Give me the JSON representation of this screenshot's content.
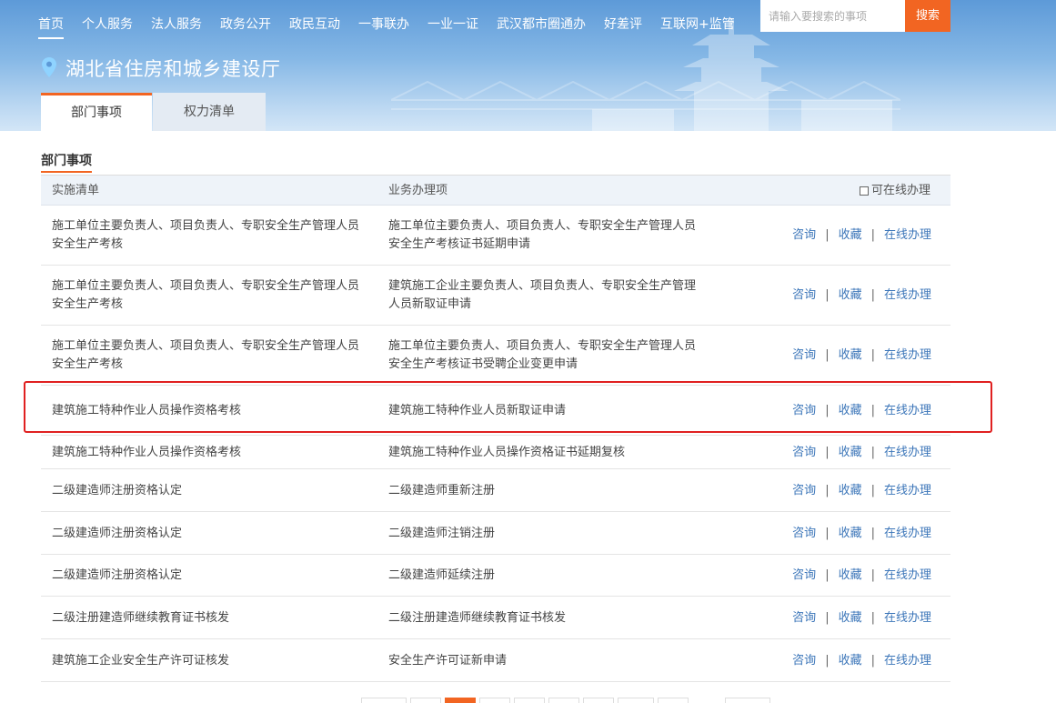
{
  "nav": {
    "items": [
      {
        "label": "首页",
        "active": true
      },
      {
        "label": "个人服务",
        "active": false
      },
      {
        "label": "法人服务",
        "active": false
      },
      {
        "label": "政务公开",
        "active": false
      },
      {
        "label": "政民互动",
        "active": false
      },
      {
        "label": "一事联办",
        "active": false
      },
      {
        "label": "一业一证",
        "active": false
      },
      {
        "label": "武汉都市圈通办",
        "active": false
      },
      {
        "label": "好差评",
        "active": false
      },
      {
        "label": "互联网+监管",
        "active": false
      }
    ]
  },
  "search": {
    "placeholder": "请输入要搜索的事项",
    "button_label": "搜索"
  },
  "department": {
    "title": "湖北省住房和城乡建设厅",
    "icon": "location-pin-icon"
  },
  "tabs": [
    {
      "label": "部门事项",
      "active": true
    },
    {
      "label": "权力清单",
      "active": false
    }
  ],
  "section": {
    "title": "部门事项"
  },
  "table": {
    "headers": {
      "implementation": "实施清单",
      "business": "业务办理项",
      "online_filter": "可在线办理"
    },
    "action_labels": {
      "consult": "咨询",
      "favorite": "收藏",
      "online": "在线办理"
    },
    "rows": [
      {
        "implementation": "施工单位主要负责人、项目负责人、专职安全生产管理人员安全生产考核",
        "business": "施工单位主要负责人、项目负责人、专职安全生产管理人员安全生产考核证书延期申请"
      },
      {
        "implementation": "施工单位主要负责人、项目负责人、专职安全生产管理人员安全生产考核",
        "business": "建筑施工企业主要负责人、项目负责人、专职安全生产管理人员新取证申请"
      },
      {
        "implementation": "施工单位主要负责人、项目负责人、专职安全生产管理人员安全生产考核",
        "business": "施工单位主要负责人、项目负责人、专职安全生产管理人员安全生产考核证书受聘企业变更申请"
      },
      {
        "implementation": "建筑施工特种作业人员操作资格考核",
        "business": "建筑施工特种作业人员新取证申请",
        "highlighted": true
      },
      {
        "implementation": "建筑施工特种作业人员操作资格考核",
        "business": "建筑施工特种作业人员操作资格证书延期复核"
      },
      {
        "implementation": "二级建造师注册资格认定",
        "business": "二级建造师重新注册"
      },
      {
        "implementation": "二级建造师注册资格认定",
        "business": "二级建造师注销注册"
      },
      {
        "implementation": "二级建造师注册资格认定",
        "business": "二级建造师延续注册"
      },
      {
        "implementation": "二级注册建造师继续教育证书核发",
        "business": "二级注册建造师继续教育证书核发"
      },
      {
        "implementation": "建筑施工企业安全生产许可证核发",
        "business": "安全生产许可证新申请"
      }
    ]
  },
  "colors": {
    "accent": "#f26522",
    "link": "#3c76b9",
    "highlight": "#e02020",
    "banner": "#6fa6dc"
  }
}
